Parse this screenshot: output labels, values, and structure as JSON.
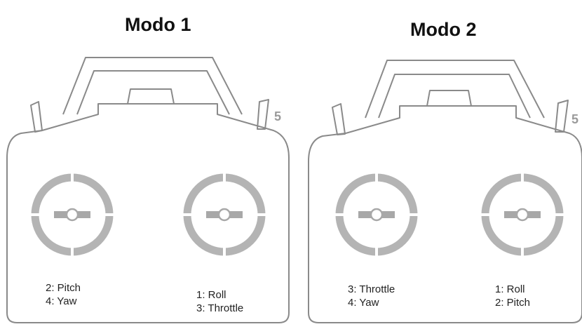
{
  "modes": [
    {
      "title": "Modo 1",
      "switch_number": "5",
      "left_stick": [
        "2: Pitch",
        "4: Yaw"
      ],
      "right_stick": [
        "1: Roll",
        "3: Throttle"
      ]
    },
    {
      "title": "Modo 2",
      "switch_number": "5",
      "left_stick": [
        "3: Throttle",
        "4: Yaw"
      ],
      "right_stick": [
        "1: Roll",
        "2: Pitch"
      ]
    }
  ],
  "colors": {
    "outline": "#8a8a8a",
    "ring": "#b4b4b4",
    "stick": "#a8a8a8",
    "number": "#9a9a9a"
  }
}
